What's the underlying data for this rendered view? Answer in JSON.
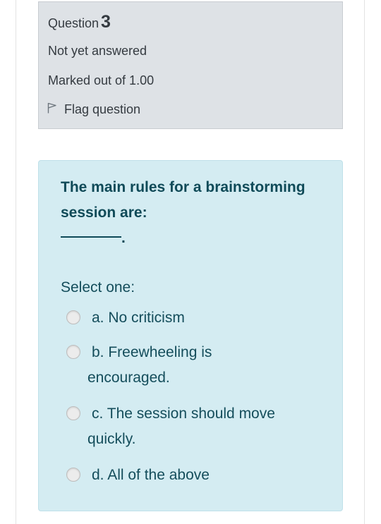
{
  "question": {
    "label": "Question",
    "number": "3",
    "state": "Not yet answered",
    "grade": "Marked out of 1.00",
    "flag_label": "Flag question"
  },
  "content": {
    "text": "The main rules for a brainstorming session are:",
    "blank_suffix": ".",
    "prompt": "Select one:",
    "options": [
      {
        "line1": "a. No criticism",
        "line2": ""
      },
      {
        "line1": "b. Freewheeling is",
        "line2": "encouraged."
      },
      {
        "line1": "c. The session should move",
        "line2": "quickly."
      },
      {
        "line1": "d. All of the above",
        "line2": ""
      }
    ]
  },
  "colors": {
    "info_bg": "#dee2e6",
    "content_bg": "#d4ecf2",
    "content_text": "#0f4a58"
  }
}
